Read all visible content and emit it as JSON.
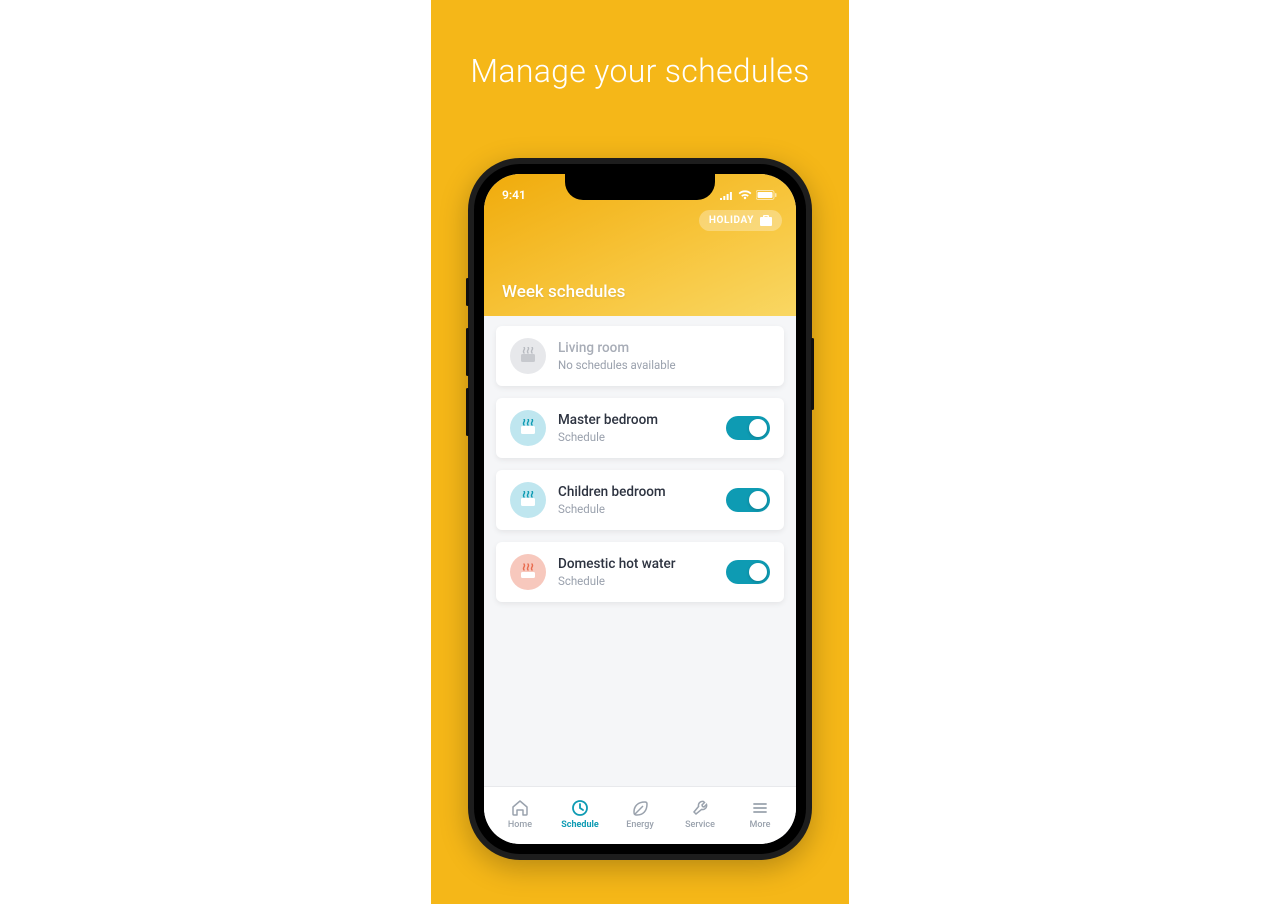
{
  "promo": {
    "title": "Manage your schedules"
  },
  "status": {
    "time": "9:41"
  },
  "holiday": {
    "label": "HOLIDAY"
  },
  "section": {
    "title": "Week schedules"
  },
  "rooms": [
    {
      "title": "Living room",
      "sub": "No schedules available",
      "icon": "radiator-disabled",
      "enabled": false
    },
    {
      "title": "Master bedroom",
      "sub": "Schedule",
      "icon": "radiator",
      "enabled": true
    },
    {
      "title": "Children bedroom",
      "sub": "Schedule",
      "icon": "radiator",
      "enabled": true
    },
    {
      "title": "Domestic hot water",
      "sub": "Schedule",
      "icon": "hotwater",
      "enabled": true
    }
  ],
  "tabs": [
    {
      "label": "Home",
      "icon": "home"
    },
    {
      "label": "Schedule",
      "icon": "schedule"
    },
    {
      "label": "Energy",
      "icon": "energy"
    },
    {
      "label": "Service",
      "icon": "service"
    },
    {
      "label": "More",
      "icon": "more"
    }
  ],
  "colors": {
    "accent": "#0e9bb3",
    "promoBg": "#f5b718"
  }
}
